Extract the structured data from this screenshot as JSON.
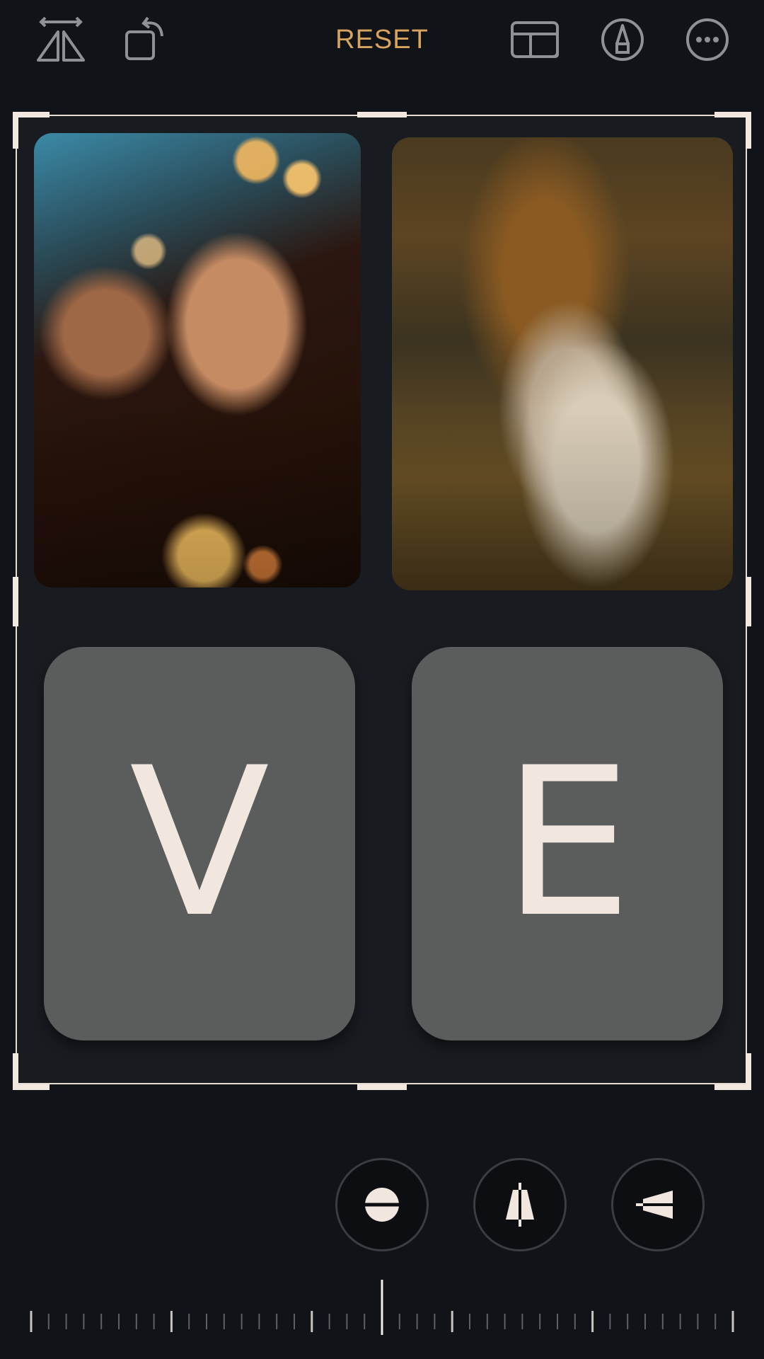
{
  "toolbar": {
    "reset_label": "RESET",
    "left_icons": [
      "flip-icon",
      "rotate-icon"
    ],
    "right_icons": [
      "aspect-ratio-icon",
      "markup-icon",
      "more-icon"
    ]
  },
  "canvas": {
    "tiles": [
      {
        "letter": "V"
      },
      {
        "letter": "E"
      }
    ]
  },
  "adjustments": [
    "straighten-icon",
    "vertical-perspective-icon",
    "horizontal-perspective-icon"
  ],
  "colors": {
    "accent": "#d8a45e",
    "background": "#101317",
    "frame": "#f2e8df",
    "tile": "#5b5c5c"
  }
}
